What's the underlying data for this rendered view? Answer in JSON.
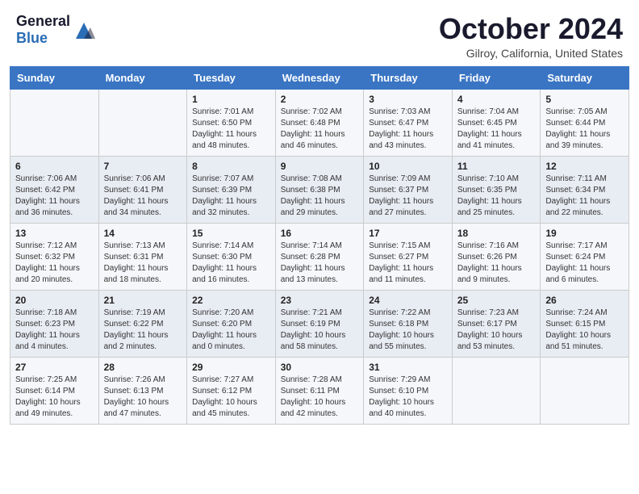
{
  "header": {
    "logo_general": "General",
    "logo_blue": "Blue",
    "month_title": "October 2024",
    "location": "Gilroy, California, United States"
  },
  "weekdays": [
    "Sunday",
    "Monday",
    "Tuesday",
    "Wednesday",
    "Thursday",
    "Friday",
    "Saturday"
  ],
  "weeks": [
    [
      {
        "day": "",
        "sunrise": "",
        "sunset": "",
        "daylight": ""
      },
      {
        "day": "",
        "sunrise": "",
        "sunset": "",
        "daylight": ""
      },
      {
        "day": "1",
        "sunrise": "Sunrise: 7:01 AM",
        "sunset": "Sunset: 6:50 PM",
        "daylight": "Daylight: 11 hours and 48 minutes."
      },
      {
        "day": "2",
        "sunrise": "Sunrise: 7:02 AM",
        "sunset": "Sunset: 6:48 PM",
        "daylight": "Daylight: 11 hours and 46 minutes."
      },
      {
        "day": "3",
        "sunrise": "Sunrise: 7:03 AM",
        "sunset": "Sunset: 6:47 PM",
        "daylight": "Daylight: 11 hours and 43 minutes."
      },
      {
        "day": "4",
        "sunrise": "Sunrise: 7:04 AM",
        "sunset": "Sunset: 6:45 PM",
        "daylight": "Daylight: 11 hours and 41 minutes."
      },
      {
        "day": "5",
        "sunrise": "Sunrise: 7:05 AM",
        "sunset": "Sunset: 6:44 PM",
        "daylight": "Daylight: 11 hours and 39 minutes."
      }
    ],
    [
      {
        "day": "6",
        "sunrise": "Sunrise: 7:06 AM",
        "sunset": "Sunset: 6:42 PM",
        "daylight": "Daylight: 11 hours and 36 minutes."
      },
      {
        "day": "7",
        "sunrise": "Sunrise: 7:06 AM",
        "sunset": "Sunset: 6:41 PM",
        "daylight": "Daylight: 11 hours and 34 minutes."
      },
      {
        "day": "8",
        "sunrise": "Sunrise: 7:07 AM",
        "sunset": "Sunset: 6:39 PM",
        "daylight": "Daylight: 11 hours and 32 minutes."
      },
      {
        "day": "9",
        "sunrise": "Sunrise: 7:08 AM",
        "sunset": "Sunset: 6:38 PM",
        "daylight": "Daylight: 11 hours and 29 minutes."
      },
      {
        "day": "10",
        "sunrise": "Sunrise: 7:09 AM",
        "sunset": "Sunset: 6:37 PM",
        "daylight": "Daylight: 11 hours and 27 minutes."
      },
      {
        "day": "11",
        "sunrise": "Sunrise: 7:10 AM",
        "sunset": "Sunset: 6:35 PM",
        "daylight": "Daylight: 11 hours and 25 minutes."
      },
      {
        "day": "12",
        "sunrise": "Sunrise: 7:11 AM",
        "sunset": "Sunset: 6:34 PM",
        "daylight": "Daylight: 11 hours and 22 minutes."
      }
    ],
    [
      {
        "day": "13",
        "sunrise": "Sunrise: 7:12 AM",
        "sunset": "Sunset: 6:32 PM",
        "daylight": "Daylight: 11 hours and 20 minutes."
      },
      {
        "day": "14",
        "sunrise": "Sunrise: 7:13 AM",
        "sunset": "Sunset: 6:31 PM",
        "daylight": "Daylight: 11 hours and 18 minutes."
      },
      {
        "day": "15",
        "sunrise": "Sunrise: 7:14 AM",
        "sunset": "Sunset: 6:30 PM",
        "daylight": "Daylight: 11 hours and 16 minutes."
      },
      {
        "day": "16",
        "sunrise": "Sunrise: 7:14 AM",
        "sunset": "Sunset: 6:28 PM",
        "daylight": "Daylight: 11 hours and 13 minutes."
      },
      {
        "day": "17",
        "sunrise": "Sunrise: 7:15 AM",
        "sunset": "Sunset: 6:27 PM",
        "daylight": "Daylight: 11 hours and 11 minutes."
      },
      {
        "day": "18",
        "sunrise": "Sunrise: 7:16 AM",
        "sunset": "Sunset: 6:26 PM",
        "daylight": "Daylight: 11 hours and 9 minutes."
      },
      {
        "day": "19",
        "sunrise": "Sunrise: 7:17 AM",
        "sunset": "Sunset: 6:24 PM",
        "daylight": "Daylight: 11 hours and 6 minutes."
      }
    ],
    [
      {
        "day": "20",
        "sunrise": "Sunrise: 7:18 AM",
        "sunset": "Sunset: 6:23 PM",
        "daylight": "Daylight: 11 hours and 4 minutes."
      },
      {
        "day": "21",
        "sunrise": "Sunrise: 7:19 AM",
        "sunset": "Sunset: 6:22 PM",
        "daylight": "Daylight: 11 hours and 2 minutes."
      },
      {
        "day": "22",
        "sunrise": "Sunrise: 7:20 AM",
        "sunset": "Sunset: 6:20 PM",
        "daylight": "Daylight: 11 hours and 0 minutes."
      },
      {
        "day": "23",
        "sunrise": "Sunrise: 7:21 AM",
        "sunset": "Sunset: 6:19 PM",
        "daylight": "Daylight: 10 hours and 58 minutes."
      },
      {
        "day": "24",
        "sunrise": "Sunrise: 7:22 AM",
        "sunset": "Sunset: 6:18 PM",
        "daylight": "Daylight: 10 hours and 55 minutes."
      },
      {
        "day": "25",
        "sunrise": "Sunrise: 7:23 AM",
        "sunset": "Sunset: 6:17 PM",
        "daylight": "Daylight: 10 hours and 53 minutes."
      },
      {
        "day": "26",
        "sunrise": "Sunrise: 7:24 AM",
        "sunset": "Sunset: 6:15 PM",
        "daylight": "Daylight: 10 hours and 51 minutes."
      }
    ],
    [
      {
        "day": "27",
        "sunrise": "Sunrise: 7:25 AM",
        "sunset": "Sunset: 6:14 PM",
        "daylight": "Daylight: 10 hours and 49 minutes."
      },
      {
        "day": "28",
        "sunrise": "Sunrise: 7:26 AM",
        "sunset": "Sunset: 6:13 PM",
        "daylight": "Daylight: 10 hours and 47 minutes."
      },
      {
        "day": "29",
        "sunrise": "Sunrise: 7:27 AM",
        "sunset": "Sunset: 6:12 PM",
        "daylight": "Daylight: 10 hours and 45 minutes."
      },
      {
        "day": "30",
        "sunrise": "Sunrise: 7:28 AM",
        "sunset": "Sunset: 6:11 PM",
        "daylight": "Daylight: 10 hours and 42 minutes."
      },
      {
        "day": "31",
        "sunrise": "Sunrise: 7:29 AM",
        "sunset": "Sunset: 6:10 PM",
        "daylight": "Daylight: 10 hours and 40 minutes."
      },
      {
        "day": "",
        "sunrise": "",
        "sunset": "",
        "daylight": ""
      },
      {
        "day": "",
        "sunrise": "",
        "sunset": "",
        "daylight": ""
      }
    ]
  ]
}
